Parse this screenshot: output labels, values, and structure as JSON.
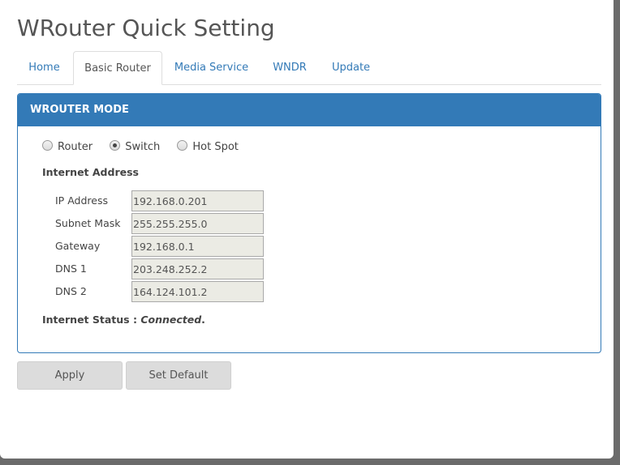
{
  "page_title": "WRouter Quick Setting",
  "tabs": [
    {
      "label": "Home",
      "active": false
    },
    {
      "label": "Basic Router",
      "active": true
    },
    {
      "label": "Media Service",
      "active": false
    },
    {
      "label": "WNDR",
      "active": false
    },
    {
      "label": "Update",
      "active": false
    }
  ],
  "panel": {
    "heading": "WROUTER MODE",
    "mode_options": [
      {
        "label": "Router",
        "checked": false
      },
      {
        "label": "Switch",
        "checked": true
      },
      {
        "label": "Hot Spot",
        "checked": false
      }
    ],
    "section_label": "Internet Address",
    "fields": [
      {
        "label": "IP Address",
        "value": "192.168.0.201"
      },
      {
        "label": "Subnet Mask",
        "value": "255.255.255.0"
      },
      {
        "label": "Gateway",
        "value": "192.168.0.1"
      },
      {
        "label": "DNS 1",
        "value": "203.248.252.2"
      },
      {
        "label": "DNS 2",
        "value": "164.124.101.2"
      }
    ],
    "status_label": "Internet Status :",
    "status_value": "Connected",
    "status_suffix": "."
  },
  "buttons": {
    "apply": "Apply",
    "set_default": "Set Default"
  },
  "colors": {
    "accent": "#337ab7",
    "tab_link": "#337ab7",
    "button_bg": "#dcdcdc"
  }
}
